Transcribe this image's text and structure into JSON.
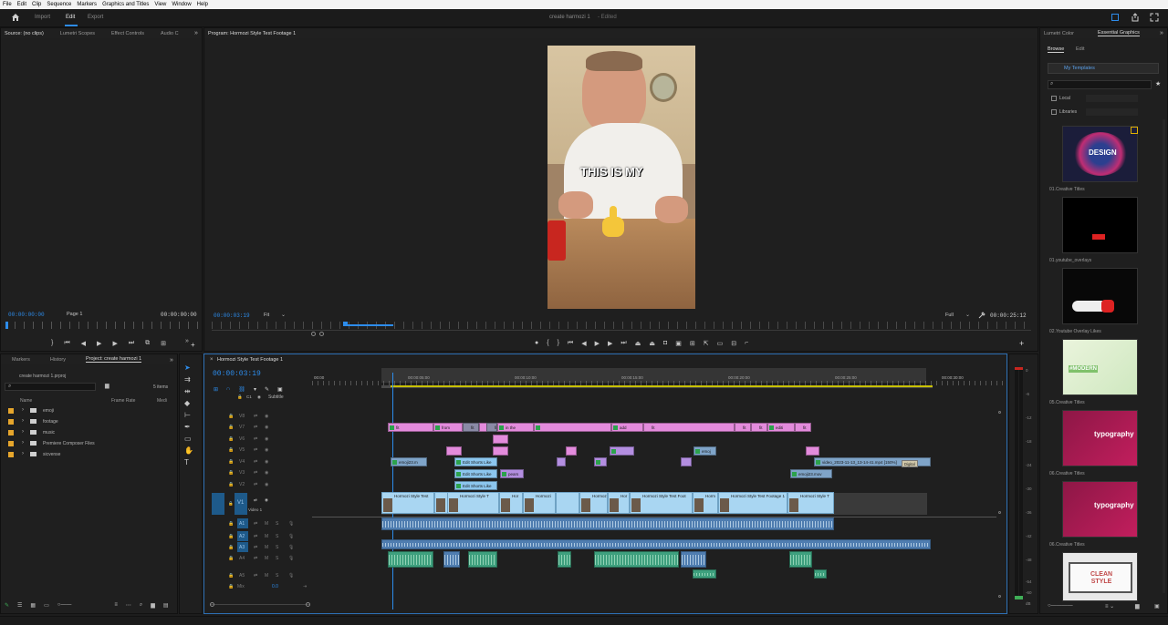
{
  "menubar": [
    "File",
    "Edit",
    "Clip",
    "Sequence",
    "Markers",
    "Graphics and Titles",
    "View",
    "Window",
    "Help"
  ],
  "header": {
    "tabs": [
      "Import",
      "Edit",
      "Export"
    ],
    "active_tab": "Edit",
    "project_title": "create harmozi 1",
    "edited": "- Edited"
  },
  "source_panel": {
    "tabs": [
      "Source: (no clips)",
      "Lumetri Scopes",
      "Effect Controls",
      "Audio C"
    ],
    "timecode_left": "00:00:00:00",
    "page": "Page 1",
    "timecode_right": "00:00:00:00"
  },
  "program_panel": {
    "tab": "Program: Hormozi Style Test Footage 1",
    "caption": "THIS IS MY",
    "timecode_left": "00:00:03:19",
    "fit": "Fit",
    "quality": "Full",
    "timecode_right": "00:00:25:12"
  },
  "project_panel": {
    "tabs": [
      "Markers",
      "History",
      "Project: create harmozi 1"
    ],
    "file": "create harmozi 1.prproj",
    "items_count": "5 items",
    "columns": [
      "Name",
      "Frame Rate",
      "Medi"
    ],
    "items": [
      "emoji",
      "footage",
      "music",
      "Premiere Composer Files",
      "sicvense"
    ]
  },
  "timeline": {
    "tab": "Hormozi Style Test Footage 1",
    "timecode": "00:00:03:19",
    "subtitle_label": "Subtitle",
    "ruler": [
      "00:00",
      "00:00:05:00",
      "00:00:10:00",
      "00:00:15:00",
      "00:00:20:00",
      "00:00:25:00",
      "00:00:30:00"
    ],
    "video_tracks": [
      "V8",
      "V7",
      "V6",
      "V5",
      "V4",
      "V3",
      "V2",
      "V1"
    ],
    "v1_name": "Video 1",
    "audio_tracks": [
      "A1",
      "A2",
      "A3",
      "A4",
      "A5"
    ],
    "mix_label": "Mix",
    "mix_value": "0.0",
    "clip_labels": {
      "pink_row": [
        "fit",
        "from",
        "fit",
        "fit",
        "in the",
        "add",
        "fit",
        "fit",
        "fit",
        "editi",
        "fit"
      ],
      "v4_emoji": "emoji23.m",
      "v4_video": "video_2023-11-13_13-14-41.mp4 [150%]",
      "v4_tip": "Digital Blur",
      "v3_edit1": "Edit Shorts Like",
      "v3_edit2": "Edit Shorts Like",
      "v3_edit3": "Edit Shorts Like",
      "v3_pears": "pears",
      "v3_emoji": "emoji23.mov",
      "emoj": "emoj",
      "v1_clips": [
        "Hormozi Style Test",
        "Hormozi Style T",
        "Hor",
        "Hormozi",
        "Hormoz",
        "Hor",
        "Hormozi Style Test Foot",
        "Horm",
        "Hormozi Style Test Footage 1",
        "Hormozi Style T"
      ]
    },
    "track_toggles": [
      "M",
      "S"
    ]
  },
  "meters": [
    "0",
    "-6",
    "-12",
    "-18",
    "-24",
    "-30",
    "-36",
    "-42",
    "-48",
    "-54",
    "-60",
    "dB"
  ],
  "right_panel": {
    "tabs": [
      "Lumetri Color",
      "Essential Graphics"
    ],
    "subtabs": [
      "Browse",
      "Edit"
    ],
    "my_templates": "My Templates",
    "filters": [
      "Local",
      "Libraries"
    ],
    "templates": [
      {
        "label": "01.Creative Titles",
        "card_text": "DESIGN"
      },
      {
        "label": "01.youtube_overlays",
        "card_text": ""
      },
      {
        "label": "02.Youtube Overlay Likes",
        "card_text": ""
      },
      {
        "label": "05.Creative Titles",
        "card_text": "#MODERN"
      },
      {
        "label": "06.Creative Titles",
        "card_text": "typography"
      },
      {
        "label": "06.Creative Titles",
        "card_text": "typography"
      },
      {
        "label": "",
        "card_text": "CLEAN STYLE"
      }
    ]
  },
  "colors": {
    "accent_blue": "#2d8ceb",
    "clip_pink": "#e38bdc",
    "clip_video": "#a9d6f2",
    "clip_audio": "#4f7db0",
    "clip_green": "#3ea07e"
  }
}
